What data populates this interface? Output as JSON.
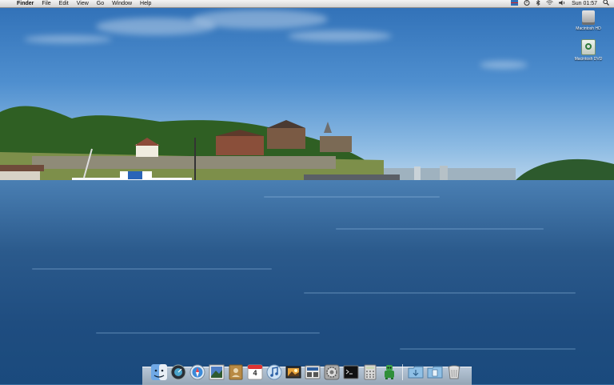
{
  "menubar": {
    "apple_glyph": "",
    "items": [
      "Finder",
      "File",
      "Edit",
      "View",
      "Go",
      "Window",
      "Help"
    ],
    "clock": "Sun 01:57"
  },
  "desktop": {
    "icons": [
      {
        "label": "Macintosh HD"
      },
      {
        "label": "Macintosh DVD"
      }
    ]
  },
  "dock": {
    "calendar_day": "4",
    "items": [
      "finder",
      "dashboard",
      "safari",
      "preview",
      "address-book",
      "ical",
      "itunes",
      "iphoto",
      "photo-booth",
      "system-preferences",
      "terminal",
      "calculator",
      "automator",
      "downloads",
      "documents",
      "trash"
    ]
  }
}
